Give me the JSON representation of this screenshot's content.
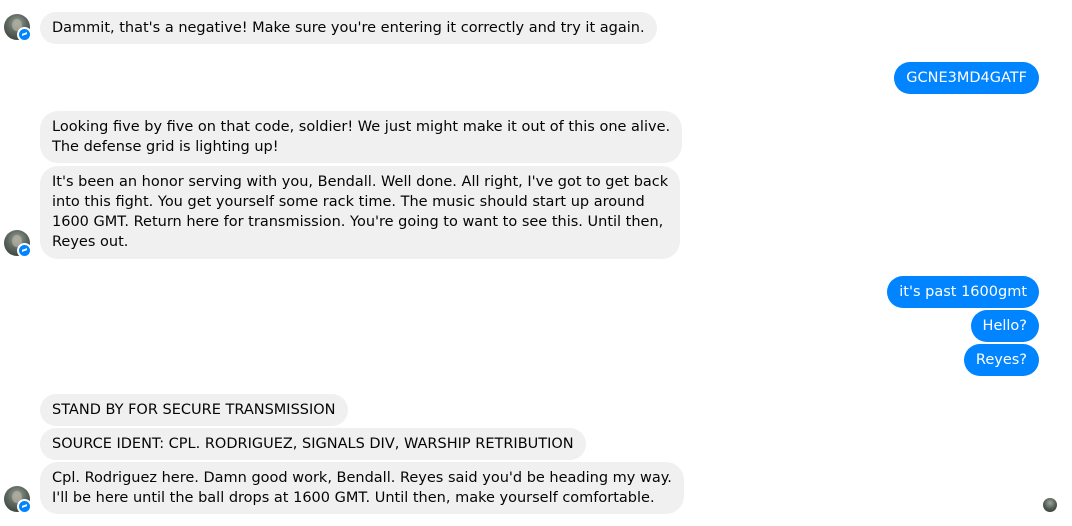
{
  "messages": [
    {
      "id": "m1",
      "from": "reyes",
      "text": "Dammit, that's a negative! Make sure you're entering it correctly and try it again."
    },
    {
      "id": "m2",
      "from": "me",
      "text": "GCNE3MD4GATF"
    },
    {
      "id": "m3",
      "from": "reyes",
      "lines": [
        "Looking five by five on that code, soldier! We just might make it out of this one alive.",
        "The defense grid is lighting up!"
      ]
    },
    {
      "id": "m4",
      "from": "reyes",
      "lines": [
        "It's been an honor serving with you, Bendall. Well done. All right, I've got to get back",
        "into this fight. You get yourself some rack time. The music should start up around",
        "1600 GMT. Return here for transmission. You're going to want to see this. Until then,",
        "Reyes out."
      ]
    },
    {
      "id": "m5",
      "from": "me",
      "text": "it's past 1600gmt"
    },
    {
      "id": "m6",
      "from": "me",
      "text": "Hello?"
    },
    {
      "id": "m7",
      "from": "me",
      "text": "Reyes?"
    },
    {
      "id": "m8",
      "from": "reyes",
      "text": "STAND BY FOR SECURE TRANSMISSION"
    },
    {
      "id": "m9",
      "from": "reyes",
      "text": "SOURCE IDENT: CPL. RODRIGUEZ, SIGNALS DIV, WARSHIP RETRIBUTION"
    },
    {
      "id": "m10",
      "from": "reyes",
      "lines": [
        "Cpl. Rodriguez here. Damn good work, Bendall. Reyes said you'd be heading my way.",
        "I'll be here until the ball drops at 1600 GMT. Until then, make yourself comfortable."
      ]
    }
  ],
  "colors": {
    "outgoing_bubble": "#0084ff",
    "incoming_bubble": "#f0f0f0",
    "messenger_badge": "#0084ff"
  },
  "icons": {
    "contact_avatar": "soldier-avatar-icon",
    "seen_indicator": "seen-avatar-icon"
  }
}
